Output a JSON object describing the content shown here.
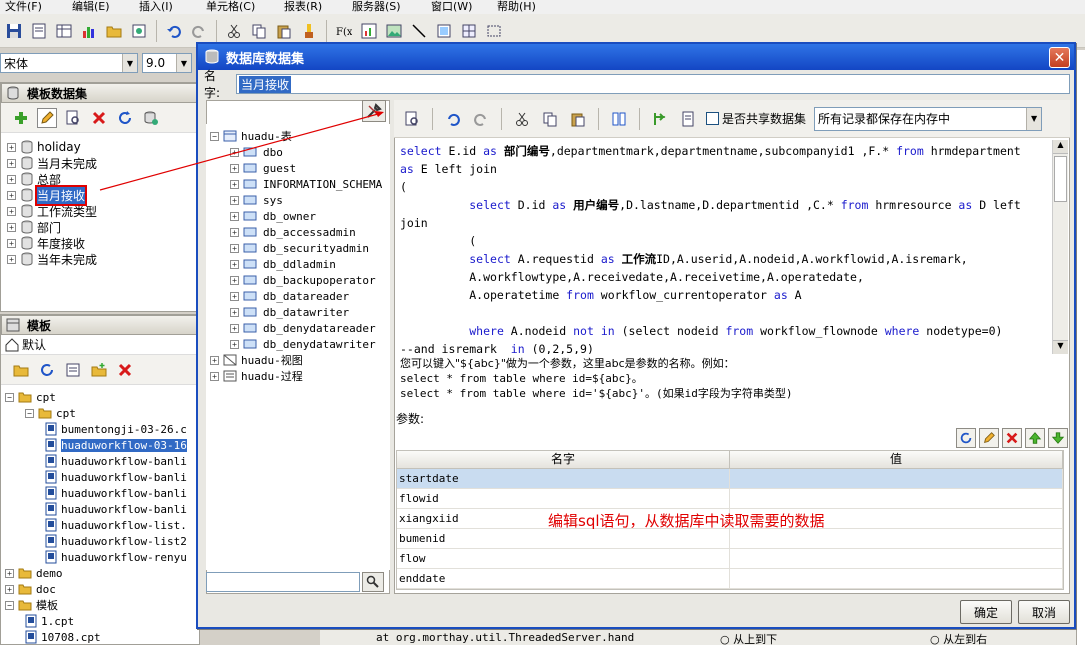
{
  "menu": [
    "文件(F)",
    "编辑(E)",
    "插入(I)",
    "单元格(C)",
    "报表(R)",
    "服务器(S)",
    "窗口(W)",
    "帮助(H)"
  ],
  "font": {
    "family": "宋体",
    "size": "9.0"
  },
  "datasets_panel": {
    "title": "模板数据集",
    "items": [
      "holiday",
      "当月未完成",
      "总部",
      "当月接收",
      "工作流类型",
      "部门",
      "年度接收",
      "当年未完成"
    ],
    "selected": "当月接收"
  },
  "template_panel": {
    "title": "模板",
    "default_label": "默认",
    "tree": [
      {
        "label": "cpt",
        "level": 0,
        "type": "folder"
      },
      {
        "label": "cpt",
        "level": 1,
        "type": "folder"
      },
      {
        "label": "bumentongji-03-26.c",
        "level": 2,
        "type": "file"
      },
      {
        "label": "huaduworkflow-03-16",
        "level": 2,
        "type": "file",
        "selected": true
      },
      {
        "label": "huaduworkflow-banli",
        "level": 2,
        "type": "file"
      },
      {
        "label": "huaduworkflow-banli",
        "level": 2,
        "type": "file"
      },
      {
        "label": "huaduworkflow-banli",
        "level": 2,
        "type": "file"
      },
      {
        "label": "huaduworkflow-banli",
        "level": 2,
        "type": "file"
      },
      {
        "label": "huaduworkflow-list.",
        "level": 2,
        "type": "file"
      },
      {
        "label": "huaduworkflow-list2",
        "level": 2,
        "type": "file"
      },
      {
        "label": "huaduworkflow-renyu",
        "level": 2,
        "type": "file"
      },
      {
        "label": "demo",
        "level": 0,
        "type": "folder"
      },
      {
        "label": "doc",
        "level": 0,
        "type": "folder"
      },
      {
        "label": "模板",
        "level": 0,
        "type": "folder"
      },
      {
        "label": "1.cpt",
        "level": 1,
        "type": "file"
      },
      {
        "label": "10708.cpt",
        "level": 1,
        "type": "file"
      }
    ]
  },
  "dialog": {
    "title": "数据库数据集",
    "name_label": "名字:",
    "name_value": "当月接收",
    "source": "huadu",
    "source_tree": {
      "tables_label": "huadu-表",
      "schemas": [
        "dbo",
        "guest",
        "INFORMATION_SCHEMA",
        "sys",
        "db_owner",
        "db_accessadmin",
        "db_securityadmin",
        "db_ddladmin",
        "db_backupoperator",
        "db_datareader",
        "db_datawriter",
        "db_denydatareader",
        "db_denydatawriter"
      ],
      "views_label": "huadu-视图",
      "procs_label": "huadu-过程"
    },
    "shared_label": "是否共享数据集",
    "cache_mode": "所有记录都保存在内存中",
    "hint_line1": "您可以键入\"${abc}\"做为一个参数，这里abc是参数的名称。例如：",
    "hint_line2": "select * from table where id=${abc}。",
    "hint_line3": "select * from table where id='${abc}'。(如果id字段为字符串类型)",
    "params_label": "参数:",
    "param_columns": [
      "名字",
      "值"
    ],
    "params": [
      "startdate",
      "flowid",
      "xiangxiid",
      "bumenid",
      "flow",
      "enddate"
    ],
    "annotation": "编辑sql语句，从数据库中读取需要的数据",
    "ok": "确定",
    "cancel": "取消"
  },
  "background": {
    "bottom_text": "at org.morthay.util.ThreadedServer.hand",
    "radio1": "从上到下",
    "radio2": "从左到右"
  }
}
